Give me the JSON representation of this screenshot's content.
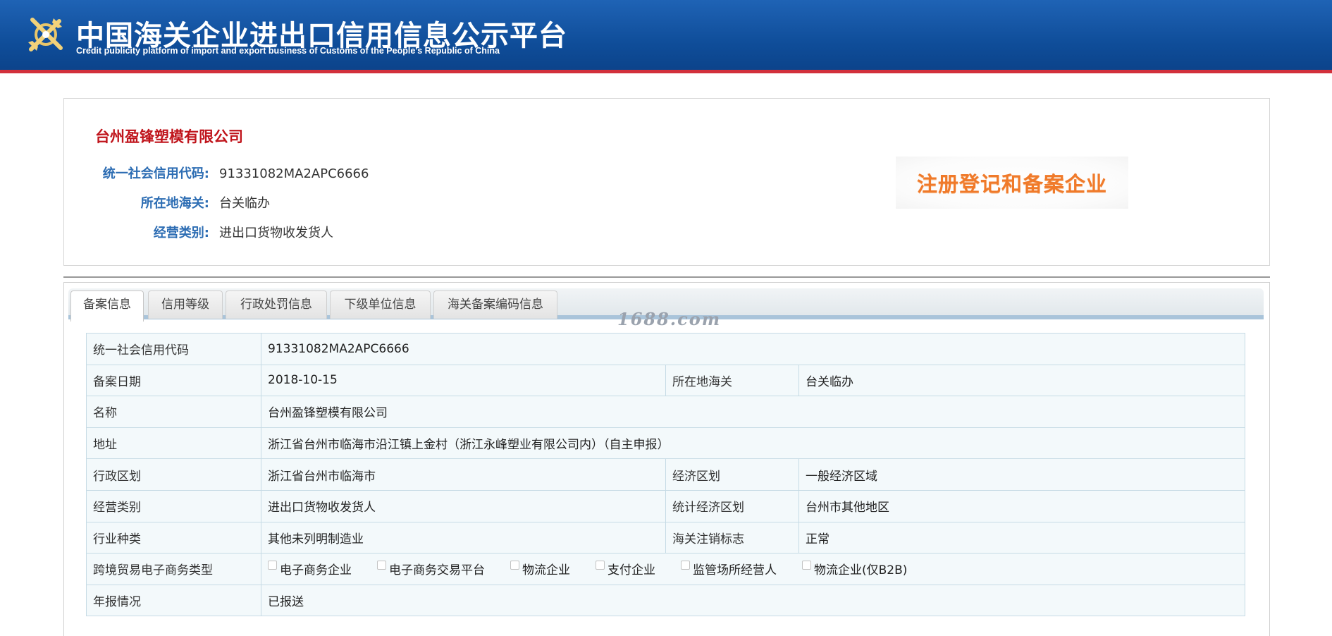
{
  "header": {
    "title": "中国海关企业进出口信用信息公示平台",
    "subtitle": "Credit publicity platform of import and export business of Customs of the People's Republic of China",
    "logo_icon": "customs-emblem-icon"
  },
  "summary": {
    "company_name": "台州盈锋塑模有限公司",
    "rows": [
      {
        "label": "统一社会信用代码:",
        "value": "91331082MA2APC6666"
      },
      {
        "label": "所在地海关:",
        "value": "台关临办"
      },
      {
        "label": "经营类别:",
        "value": "进出口货物收发货人"
      }
    ],
    "stamp": "注册登记和备案企业"
  },
  "tabs": [
    {
      "label": "备案信息",
      "active": true
    },
    {
      "label": "信用等级",
      "active": false
    },
    {
      "label": "行政处罚信息",
      "active": false
    },
    {
      "label": "下级单位信息",
      "active": false
    },
    {
      "label": "海关备案编码信息",
      "active": false
    }
  ],
  "watermark": "1688.com",
  "details": {
    "credit_code": {
      "label": "统一社会信用代码",
      "value": "91331082MA2APC6666"
    },
    "filing_date": {
      "label": "备案日期",
      "value": "2018-10-15"
    },
    "customs": {
      "label": "所在地海关",
      "value": "台关临办"
    },
    "name": {
      "label": "名称",
      "value": "台州盈锋塑模有限公司"
    },
    "address": {
      "label": "地址",
      "value": "浙江省台州市临海市沿江镇上金村（浙江永峰塑业有限公司内）（自主申报）"
    },
    "admin_region": {
      "label": "行政区划",
      "value": "浙江省台州市临海市"
    },
    "econ_region": {
      "label": "经济区划",
      "value": "一般经济区域"
    },
    "business_type": {
      "label": "经营类别",
      "value": "进出口货物收发货人"
    },
    "stat_region": {
      "label": "统计经济区划",
      "value": "台州市其他地区"
    },
    "industry": {
      "label": "行业种类",
      "value": "其他未列明制造业"
    },
    "cancel_flag": {
      "label": "海关注销标志",
      "value": "正常"
    },
    "ecommerce": {
      "label": "跨境贸易电子商务类型",
      "options": [
        "电子商务企业",
        "电子商务交易平台",
        "物流企业",
        "支付企业",
        "监管场所经营人",
        "物流企业(仅B2B)"
      ]
    },
    "annual_report": {
      "label": "年报情况",
      "value": "已报送"
    }
  }
}
